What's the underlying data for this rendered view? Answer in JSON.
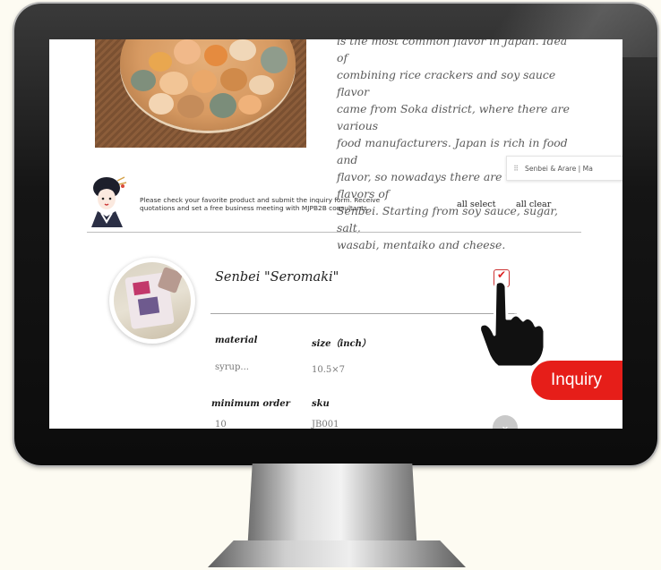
{
  "page": {
    "intro_lines": [
      "is the most common flavor in Japan. Idea of",
      "combining rice crackers and soy sauce flavor",
      "came from Soka district, where there are various",
      "food manufacturers. Japan is rich in food and",
      "flavor, so nowadays there are various flavors of",
      "Senbei. Starting from soy sauce, sugar, salt,",
      "wasabi, mentaiko and cheese."
    ],
    "floating_tab_label": "Senbei & Arare | Ma",
    "check_message": "Please check your favorite product and submit the inquiry form. Receive quotations and set a free business meeting with MJPB2B consultants.",
    "all_select": "all select",
    "all_clear": "all clear",
    "inquiry_button": "Inquiry"
  },
  "product": {
    "name": "Senbei \"Seromaki\"",
    "checked": true,
    "specs": {
      "material_label": "material",
      "material_value": "syrup...",
      "size_label": "size（inch）",
      "size_value": "10.5×7",
      "min_order_label": "minimum order",
      "min_order_value": "10",
      "sku_label": "sku",
      "sku_value": "JB001"
    }
  },
  "icons": {
    "grip": "grip-icon",
    "check": "check-icon",
    "pointer": "hand-pointer-icon",
    "expand": "chevron-down-icon"
  },
  "colors": {
    "inquiry_red": "#e61e19",
    "checkbox_red": "#d22222",
    "background": "#fdfbf2"
  }
}
